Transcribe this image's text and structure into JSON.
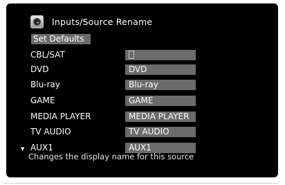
{
  "header": {
    "title": "Inputs/Source Rename",
    "icon": "speaker-icon"
  },
  "buttons": {
    "set_defaults": "Set Defaults"
  },
  "rows": [
    {
      "label": "CBL/SAT",
      "value": ""
    },
    {
      "label": "DVD",
      "value": "DVD"
    },
    {
      "label": "Blu-ray",
      "value": "Blu-ray"
    },
    {
      "label": "GAME",
      "value": "GAME"
    },
    {
      "label": "MEDIA PLAYER",
      "value": "MEDIA PLAYER"
    },
    {
      "label": "TV AUDIO",
      "value": "TV AUDIO"
    },
    {
      "label": "AUX1",
      "value": "AUX1"
    }
  ],
  "help_text": "Changes the display name for this source",
  "colors": {
    "background": "#000000",
    "field": "#6b6b6b",
    "text": "#ffffff"
  }
}
